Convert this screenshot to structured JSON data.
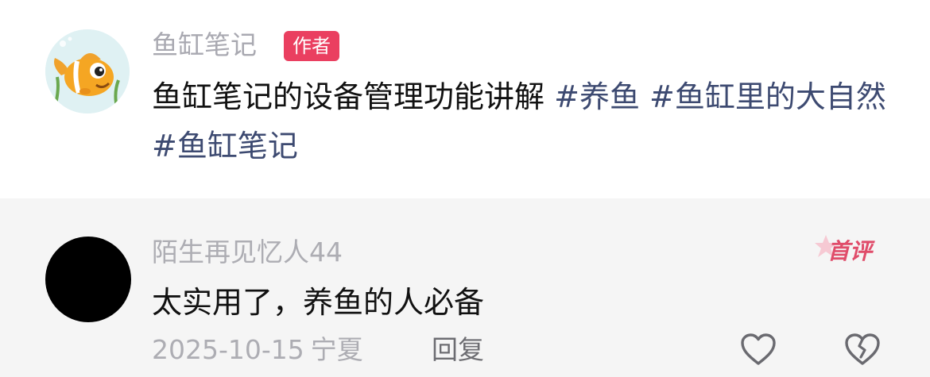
{
  "post": {
    "author": "鱼缸笔记",
    "author_badge": "作者",
    "text": "鱼缸笔记的设备管理功能讲解",
    "tags": [
      "#养鱼",
      "#鱼缸里的大自然",
      "#鱼缸笔记"
    ],
    "avatar_icon": "goldfish-cartoon-avatar"
  },
  "comment": {
    "username": "陌生再见忆人44",
    "badge": "首评",
    "text": "太实用了，养鱼的人必备",
    "date": "2025-10-15",
    "location": "宁夏",
    "reply_label": "回复",
    "like_icon": "heart-outline-icon",
    "dislike_icon": "broken-heart-outline-icon"
  },
  "colors": {
    "tag": "#3d4a71",
    "badge_author": "#ea3f60",
    "badge_first": "#e04c6a",
    "muted_text": "#adadb3",
    "comment_bg": "#f5f5f5"
  }
}
